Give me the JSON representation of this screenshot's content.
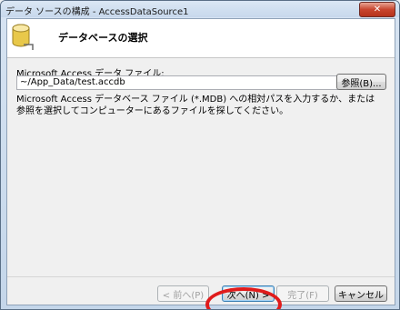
{
  "window": {
    "title": "データ ソースの構成 - AccessDataSource1",
    "close_label": "✕"
  },
  "header": {
    "title": "データベースの選択",
    "icon": "database-icon"
  },
  "form": {
    "label": "Microsoft Access データ ファイル:",
    "path_value": "~/App_Data/test.accdb",
    "browse_label": "参照(B)...",
    "description": "Microsoft Access データベース ファイル (*.MDB) への相対パスを入力するか、または参照を選択してコンピューターにあるファイルを探してください。"
  },
  "footer": {
    "back_label": "< 前へ(P)",
    "next_label": "次へ(N) >",
    "finish_label": "完了(F)",
    "cancel_label": "キャンセル"
  },
  "colors": {
    "highlight": "#e01b1b",
    "database_icon": "#e8c84a"
  }
}
